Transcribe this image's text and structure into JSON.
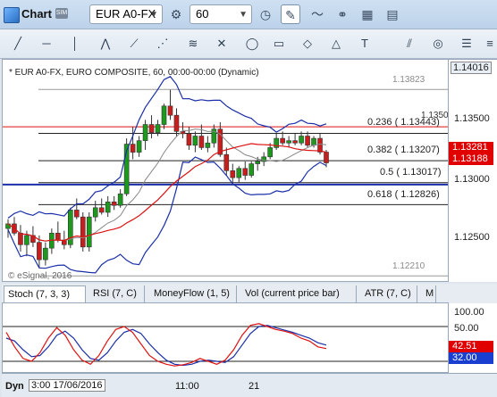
{
  "window": {
    "title": "Chart",
    "badge": "SIM"
  },
  "toolbar": {
    "symbol": "EUR A0-FX",
    "interval": "60",
    "icons": [
      "settings-icon",
      "clock-icon",
      "pencil-icon",
      "chart-style-icon",
      "link-icon",
      "grid-icon",
      "panel-icon"
    ]
  },
  "drawing_tools": [
    "line-tool",
    "horizontal-line-tool",
    "vertical-line-tool",
    "zigzag-tool",
    "fan-tool",
    "gann-tool",
    "wave-tool",
    "crossline-tool",
    "ellipse-tool",
    "rectangle-tool",
    "diamond-tool",
    "triangle-tool",
    "text-tool",
    "channel-tool",
    "cycles-tool",
    "pitchfork-tool",
    "fib-tool"
  ],
  "chart": {
    "legend": "* EUR A0-FX, EURO COMPOSITE, 60, 00:00-00:00 (Dynamic)",
    "watermark": "© eSignal, 2016",
    "fib_labels": [
      {
        "text": "0.236 ( 1.13443)",
        "level": 1.13443
      },
      {
        "text": "0.382 ( 1.13207)",
        "level": 1.13207
      },
      {
        "text": "0.5 ( 1.13017)",
        "level": 1.13017
      },
      {
        "text": "0.618 ( 1.12826)",
        "level": 1.12826
      }
    ],
    "high_label": "1.13823",
    "low_label": "1.12210",
    "extra_label": "1.13500",
    "y_ticks": [
      "1.14016",
      "1.13500",
      "1.13000",
      "1.12500"
    ],
    "price_tags": [
      {
        "text": "1.13281",
        "color": "#e00000"
      },
      {
        "text": "1.13188",
        "color": "#e00000"
      }
    ]
  },
  "indicator_tabs": [
    "Stoch (7, 3, 3)",
    "RSI (7, C)",
    "MoneyFlow (1, 5)",
    "Vol (current price bar)",
    "ATR (7, C)",
    "M"
  ],
  "stoch": {
    "y_ticks": [
      "100.00",
      "50.00"
    ],
    "tags": [
      {
        "text": "42.51",
        "color": "#e00000"
      },
      {
        "text": "32.00",
        "color": "#1a3fd0"
      }
    ]
  },
  "x_axis": {
    "dyn_label": "Dyn",
    "date_label": "3:00 17/06/2016",
    "ticks": [
      "11:00",
      "21"
    ]
  },
  "chart_data": {
    "type": "candlestick",
    "candles": [
      [
        1.1262,
        1.127,
        1.1254,
        1.1266
      ],
      [
        1.1266,
        1.1272,
        1.1256,
        1.1258
      ],
      [
        1.1258,
        1.1265,
        1.1242,
        1.1248
      ],
      [
        1.1248,
        1.126,
        1.1238,
        1.1256
      ],
      [
        1.1256,
        1.1264,
        1.1246,
        1.125
      ],
      [
        1.125,
        1.1256,
        1.1228,
        1.1235
      ],
      [
        1.1235,
        1.125,
        1.123,
        1.1245
      ],
      [
        1.1245,
        1.1262,
        1.124,
        1.1258
      ],
      [
        1.1258,
        1.1268,
        1.125,
        1.1252
      ],
      [
        1.1252,
        1.126,
        1.1244,
        1.1248
      ],
      [
        1.1248,
        1.128,
        1.1245,
        1.1278
      ],
      [
        1.1278,
        1.1288,
        1.127,
        1.1272
      ],
      [
        1.1272,
        1.1276,
        1.1242,
        1.1246
      ],
      [
        1.1246,
        1.1276,
        1.1242,
        1.1272
      ],
      [
        1.1272,
        1.1286,
        1.1268,
        1.128
      ],
      [
        1.128,
        1.1288,
        1.1274,
        1.1276
      ],
      [
        1.1276,
        1.129,
        1.1272,
        1.1285
      ],
      [
        1.1285,
        1.129,
        1.1278,
        1.1282
      ],
      [
        1.1282,
        1.1296,
        1.128,
        1.1292
      ],
      [
        1.1292,
        1.134,
        1.129,
        1.1335
      ],
      [
        1.1335,
        1.135,
        1.1322,
        1.1328
      ],
      [
        1.1328,
        1.1342,
        1.1324,
        1.1338
      ],
      [
        1.1338,
        1.1356,
        1.133,
        1.1352
      ],
      [
        1.1352,
        1.136,
        1.134,
        1.1345
      ],
      [
        1.1345,
        1.1356,
        1.1342,
        1.1352
      ],
      [
        1.1352,
        1.137,
        1.1348,
        1.1368
      ],
      [
        1.1368,
        1.1382,
        1.1356,
        1.136
      ],
      [
        1.136,
        1.1366,
        1.1342,
        1.1346
      ],
      [
        1.1346,
        1.1354,
        1.134,
        1.1344
      ],
      [
        1.1344,
        1.135,
        1.133,
        1.1334
      ],
      [
        1.1334,
        1.1346,
        1.1328,
        1.1342
      ],
      [
        1.1342,
        1.1352,
        1.133,
        1.1332
      ],
      [
        1.1332,
        1.1342,
        1.1328,
        1.1336
      ],
      [
        1.1336,
        1.1352,
        1.1332,
        1.1348
      ],
      [
        1.1348,
        1.1354,
        1.1324,
        1.1326
      ],
      [
        1.1326,
        1.1332,
        1.1308,
        1.1312
      ],
      [
        1.1312,
        1.1318,
        1.13,
        1.1306
      ],
      [
        1.1306,
        1.1316,
        1.1302,
        1.1314
      ],
      [
        1.1314,
        1.132,
        1.1304,
        1.1308
      ],
      [
        1.1308,
        1.132,
        1.1306,
        1.1318
      ],
      [
        1.1318,
        1.1324,
        1.1312,
        1.132
      ],
      [
        1.132,
        1.1328,
        1.1316,
        1.1324
      ],
      [
        1.1324,
        1.1336,
        1.1322,
        1.1332
      ],
      [
        1.1332,
        1.1344,
        1.133,
        1.134
      ],
      [
        1.134,
        1.1346,
        1.1334,
        1.1336
      ],
      [
        1.1336,
        1.1342,
        1.1332,
        1.1338
      ],
      [
        1.1338,
        1.1344,
        1.1334,
        1.1336
      ],
      [
        1.1336,
        1.1346,
        1.1334,
        1.1342
      ],
      [
        1.1342,
        1.1346,
        1.1332,
        1.1334
      ],
      [
        1.1334,
        1.1342,
        1.1332,
        1.134
      ],
      [
        1.134,
        1.1344,
        1.1326,
        1.13281
      ],
      [
        1.13281,
        1.133,
        1.1315,
        1.13188
      ]
    ],
    "y_range": [
      1.1215,
      1.1408
    ],
    "stoch_k": [
      70,
      45,
      25,
      20,
      35,
      60,
      78,
      65,
      40,
      22,
      15,
      30,
      55,
      75,
      80,
      70,
      50,
      30,
      20,
      15,
      12,
      14,
      18,
      25,
      20,
      15,
      22,
      40,
      65,
      82,
      85,
      80,
      75,
      72,
      68,
      60,
      55,
      45,
      42
    ],
    "stoch_d": [
      60,
      55,
      40,
      28,
      30,
      45,
      65,
      72,
      60,
      40,
      25,
      22,
      35,
      55,
      70,
      75,
      68,
      50,
      35,
      22,
      15,
      13,
      15,
      20,
      22,
      20,
      18,
      28,
      48,
      68,
      80,
      82,
      78,
      74,
      70,
      65,
      60,
      52,
      48
    ],
    "stoch_range": [
      0,
      120
    ]
  }
}
